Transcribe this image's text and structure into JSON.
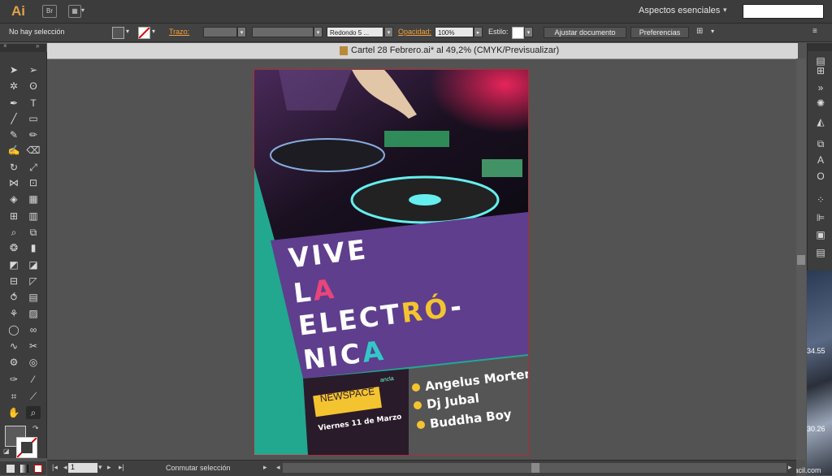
{
  "app": {
    "logo": "Ai",
    "bridge_label": "Br",
    "workspace": "Aspectos esenciales"
  },
  "control": {
    "selection": "No hay selección",
    "stroke_label": "Trazo:",
    "brush_label": "Redondo 5 ...",
    "opacity_label": "Opacidad:",
    "opacity_value": "100%",
    "style_label": "Estilo:",
    "adjust_doc": "Ajustar documento",
    "preferences": "Preferencias"
  },
  "document": {
    "title": "Cartel 28 Febrero.ai* al 49,2% (CMYK/Previsualizar)"
  },
  "statusbar": {
    "page": "1",
    "toggle": "Conmutar selección"
  },
  "right_numbers": {
    "n1": "34.55",
    "n2": "30.26",
    "watermark": "AulaFacil.com"
  },
  "poster": {
    "headline": [
      "VIVE",
      "LA",
      "ELECTRÓ-",
      "NICA"
    ],
    "logo_text": "NEWSPACE",
    "logo_small": "ancla",
    "date": "Viernes 11 de Marzo",
    "artists": [
      "Angelus Morten",
      "Dj Jubal",
      "Buddha Boy"
    ]
  },
  "colors": {
    "purple": "#5f3e8e",
    "teal": "#22a88f",
    "gray": "#555555",
    "dark": "#2a1b2a",
    "yellow": "#f4c430",
    "pink": "#e8457a",
    "cyan": "#32c8c8"
  }
}
